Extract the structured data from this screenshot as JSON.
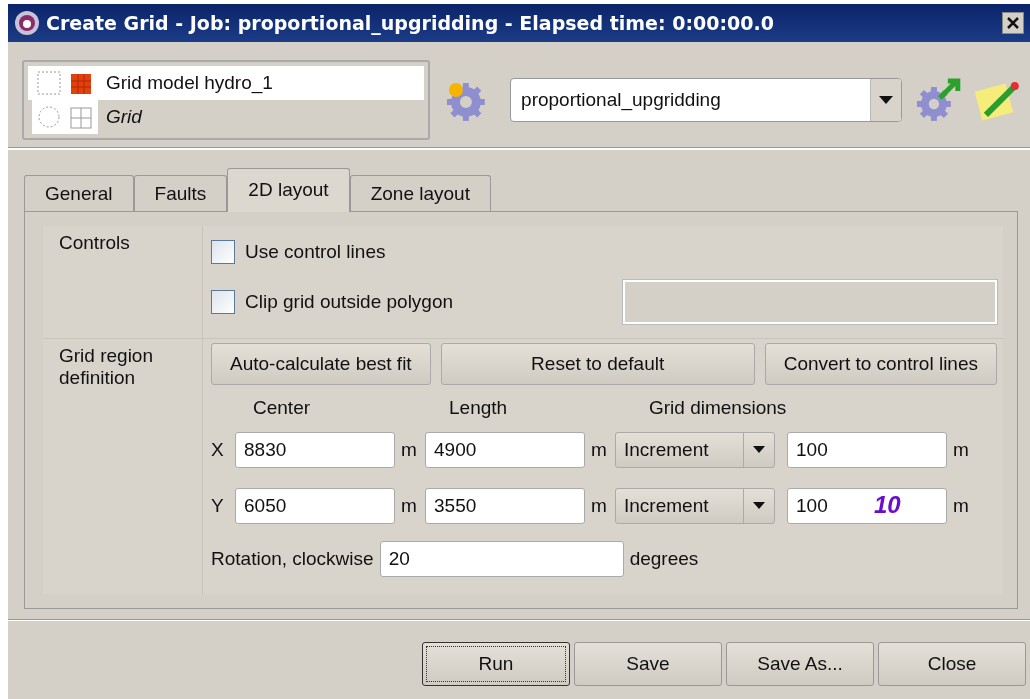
{
  "window": {
    "title": "Create Grid - Job: proportional_upgridding - Elapsed time: 0:00:00.0"
  },
  "inputs": [
    {
      "label": "Grid model hydro_1",
      "selected": true
    },
    {
      "label": "Grid",
      "selected": false
    }
  ],
  "job": {
    "value": "proportional_upgridding"
  },
  "tabs": [
    {
      "label": "General",
      "selected": false
    },
    {
      "label": "Faults",
      "selected": false
    },
    {
      "label": "2D layout",
      "selected": true
    },
    {
      "label": "Zone layout",
      "selected": false
    }
  ],
  "controls": {
    "label": "Controls",
    "options": [
      {
        "label": "Use control lines",
        "checked": false
      },
      {
        "label": "Clip grid outside polygon",
        "checked": false
      }
    ]
  },
  "grid_region": {
    "label": "Grid region definition",
    "buttons": [
      "Auto-calculate best fit",
      "Reset to default",
      "Convert to control lines"
    ],
    "headers": [
      "Center",
      "Length",
      "Grid dimensions"
    ],
    "rows": [
      {
        "axis": "X",
        "center": "8830",
        "center_unit": "m",
        "length": "4900",
        "length_unit": "m",
        "mode": "Increment",
        "dimension": "100",
        "dimension_unit": "m"
      },
      {
        "axis": "Y",
        "center": "6050",
        "center_unit": "m",
        "length": "3550",
        "length_unit": "m",
        "mode": "Increment",
        "dimension": "100",
        "dimension_unit": "m",
        "annotation": "10"
      }
    ],
    "rotation": {
      "label": "Rotation, clockwise",
      "value": "20",
      "unit": "degrees"
    }
  },
  "buttons": [
    {
      "label": "Run",
      "focused": true
    },
    {
      "label": "Save",
      "focused": false
    },
    {
      "label": "Save As...",
      "focused": false
    },
    {
      "label": "Close",
      "focused": false
    }
  ]
}
